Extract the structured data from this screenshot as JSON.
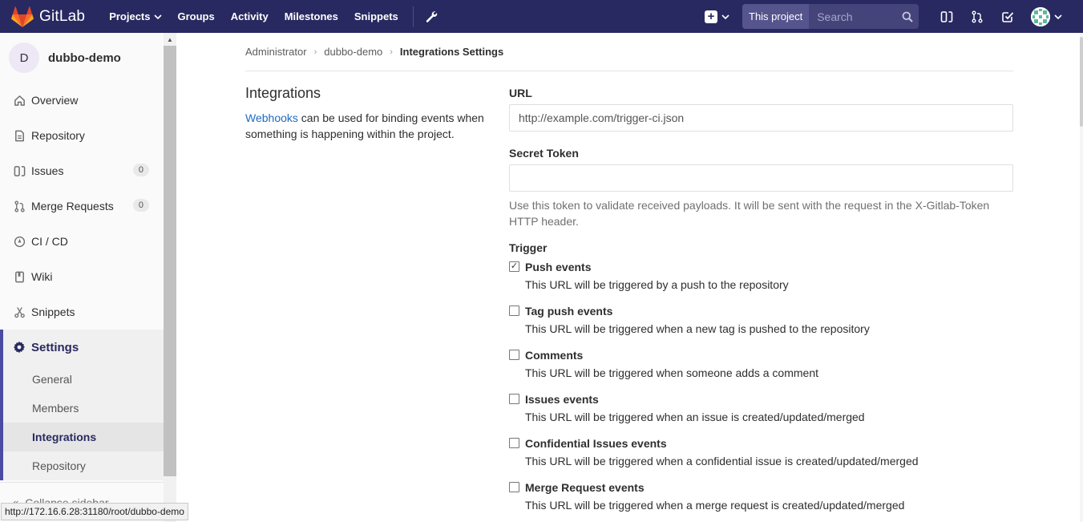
{
  "navbar": {
    "brand": "GitLab",
    "links": [
      {
        "label": "Projects",
        "caret": true
      },
      {
        "label": "Groups"
      },
      {
        "label": "Activity"
      },
      {
        "label": "Milestones"
      },
      {
        "label": "Snippets"
      }
    ],
    "search_scope": "This project",
    "search_placeholder": "Search",
    "colors": {
      "bg": "#292961",
      "accent": "#fc6d26"
    }
  },
  "sidebar": {
    "project_initial": "D",
    "project_name": "dubbo-demo",
    "items": [
      {
        "label": "Overview",
        "icon": "home-icon"
      },
      {
        "label": "Repository",
        "icon": "doc-icon"
      },
      {
        "label": "Issues",
        "icon": "issues-icon",
        "count": "0"
      },
      {
        "label": "Merge Requests",
        "icon": "merge-request-icon",
        "count": "0"
      },
      {
        "label": "CI / CD",
        "icon": "rocket-icon"
      },
      {
        "label": "Wiki",
        "icon": "book-icon"
      },
      {
        "label": "Snippets",
        "icon": "scissors-icon"
      }
    ],
    "active": {
      "label": "Settings",
      "icon": "gear-icon"
    },
    "subitems": [
      "General",
      "Members",
      "Integrations",
      "Repository"
    ],
    "collapse_label": "Collapse sidebar"
  },
  "status_url": "http://172.16.6.28:31180/root/dubbo-demo",
  "breadcrumb": [
    "Administrator",
    "dubbo-demo",
    "Integrations Settings"
  ],
  "intro": {
    "title": "Integrations",
    "link": "Webhooks",
    "text": " can be used for binding events when something is happening within the project."
  },
  "form": {
    "url_label": "URL",
    "url_placeholder": "http://example.com/trigger-ci.json",
    "token_label": "Secret Token",
    "token_help": "Use this token to validate received payloads. It will be sent with the request in the X-Gitlab-Token HTTP header.",
    "trigger_label": "Trigger",
    "triggers": [
      {
        "title": "Push events",
        "checked": true,
        "desc": "This URL will be triggered by a push to the repository"
      },
      {
        "title": "Tag push events",
        "checked": false,
        "desc": "This URL will be triggered when a new tag is pushed to the repository"
      },
      {
        "title": "Comments",
        "checked": false,
        "desc": "This URL will be triggered when someone adds a comment"
      },
      {
        "title": "Issues events",
        "checked": false,
        "desc": "This URL will be triggered when an issue is created/updated/merged"
      },
      {
        "title": "Confidential Issues events",
        "checked": false,
        "desc": "This URL will be triggered when a confidential issue is created/updated/merged"
      },
      {
        "title": "Merge Request events",
        "checked": false,
        "desc": "This URL will be triggered when a merge request is created/updated/merged"
      }
    ]
  }
}
